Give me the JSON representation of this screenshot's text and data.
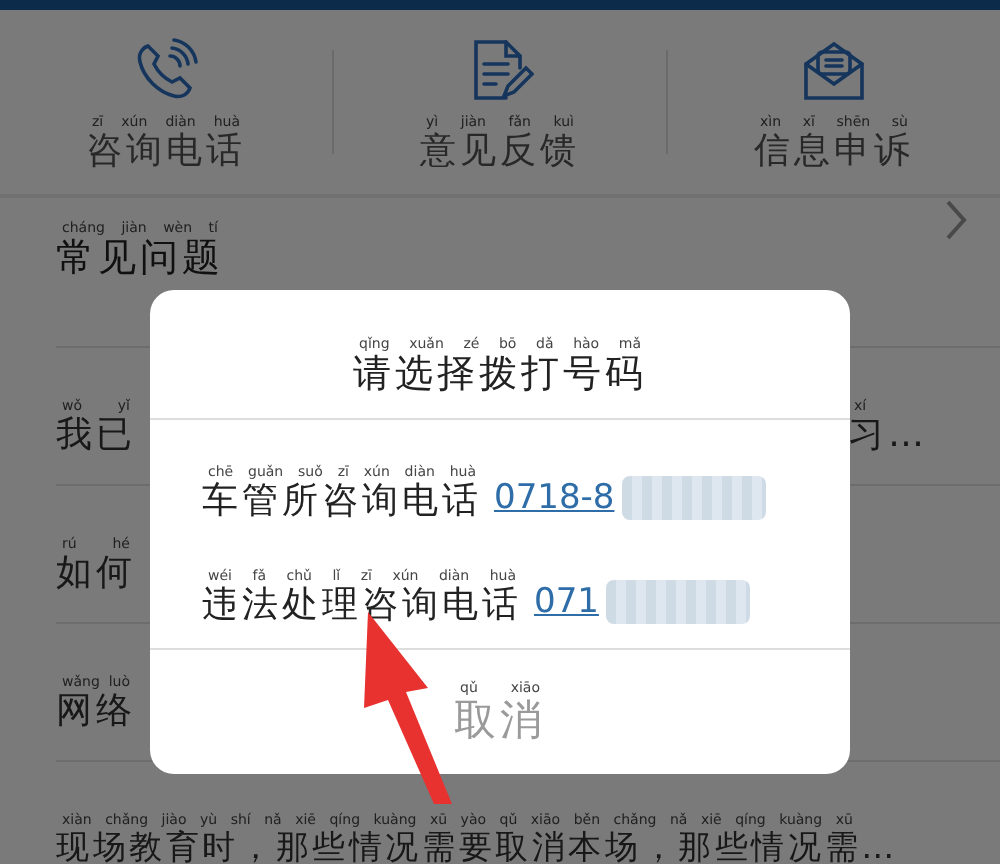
{
  "header": {
    "tabs": [
      {
        "kind": "phone",
        "label": {
          "text": "咨询电话",
          "pinyin": "zī xún diàn huà"
        }
      },
      {
        "kind": "document",
        "label": {
          "text": "意见反馈",
          "pinyin": "yì jiàn fǎn kuì"
        }
      },
      {
        "kind": "envelope",
        "label": {
          "text": "信息申诉",
          "pinyin": "xìn xī shēn sù"
        }
      }
    ]
  },
  "faq": {
    "heading": {
      "text": "常见问题",
      "pinyin": "cháng jiàn wèn tí"
    },
    "rows": [
      {
        "left": {
          "text": "我已",
          "pinyin": "wǒ yǐ"
        },
        "right": {
          "text": "习…",
          "pinyin": "xí"
        }
      },
      {
        "left": {
          "text": "如何",
          "pinyin": "rú hé"
        }
      },
      {
        "left": {
          "text": "网络",
          "pinyin": "wǎng luò"
        }
      },
      {
        "left": {
          "text": "现场教育时，那些情况需要取消本场，那些情况需…",
          "pinyin": "xiàn chǎng jiào yù shí nǎ xiē qíng kuàng xū yào qǔ xiāo běn chǎng nǎ xiē qíng kuàng xū"
        }
      }
    ]
  },
  "dialog": {
    "title": {
      "text": "请选择拨打号码",
      "pinyin": "qǐng xuǎn zé bō dǎ hào mǎ"
    },
    "options": [
      {
        "label": {
          "text": "车管所咨询电话",
          "pinyin": "chē guǎn suǒ zī xún diàn huà"
        },
        "number": "0718-8"
      },
      {
        "label": {
          "text": "违法处理咨询电话",
          "pinyin": "wéi fǎ chǔ lǐ zī xún diàn huà"
        },
        "number": "071"
      }
    ],
    "cancel": {
      "text": "取消",
      "pinyin": "qǔ xiāo"
    }
  }
}
